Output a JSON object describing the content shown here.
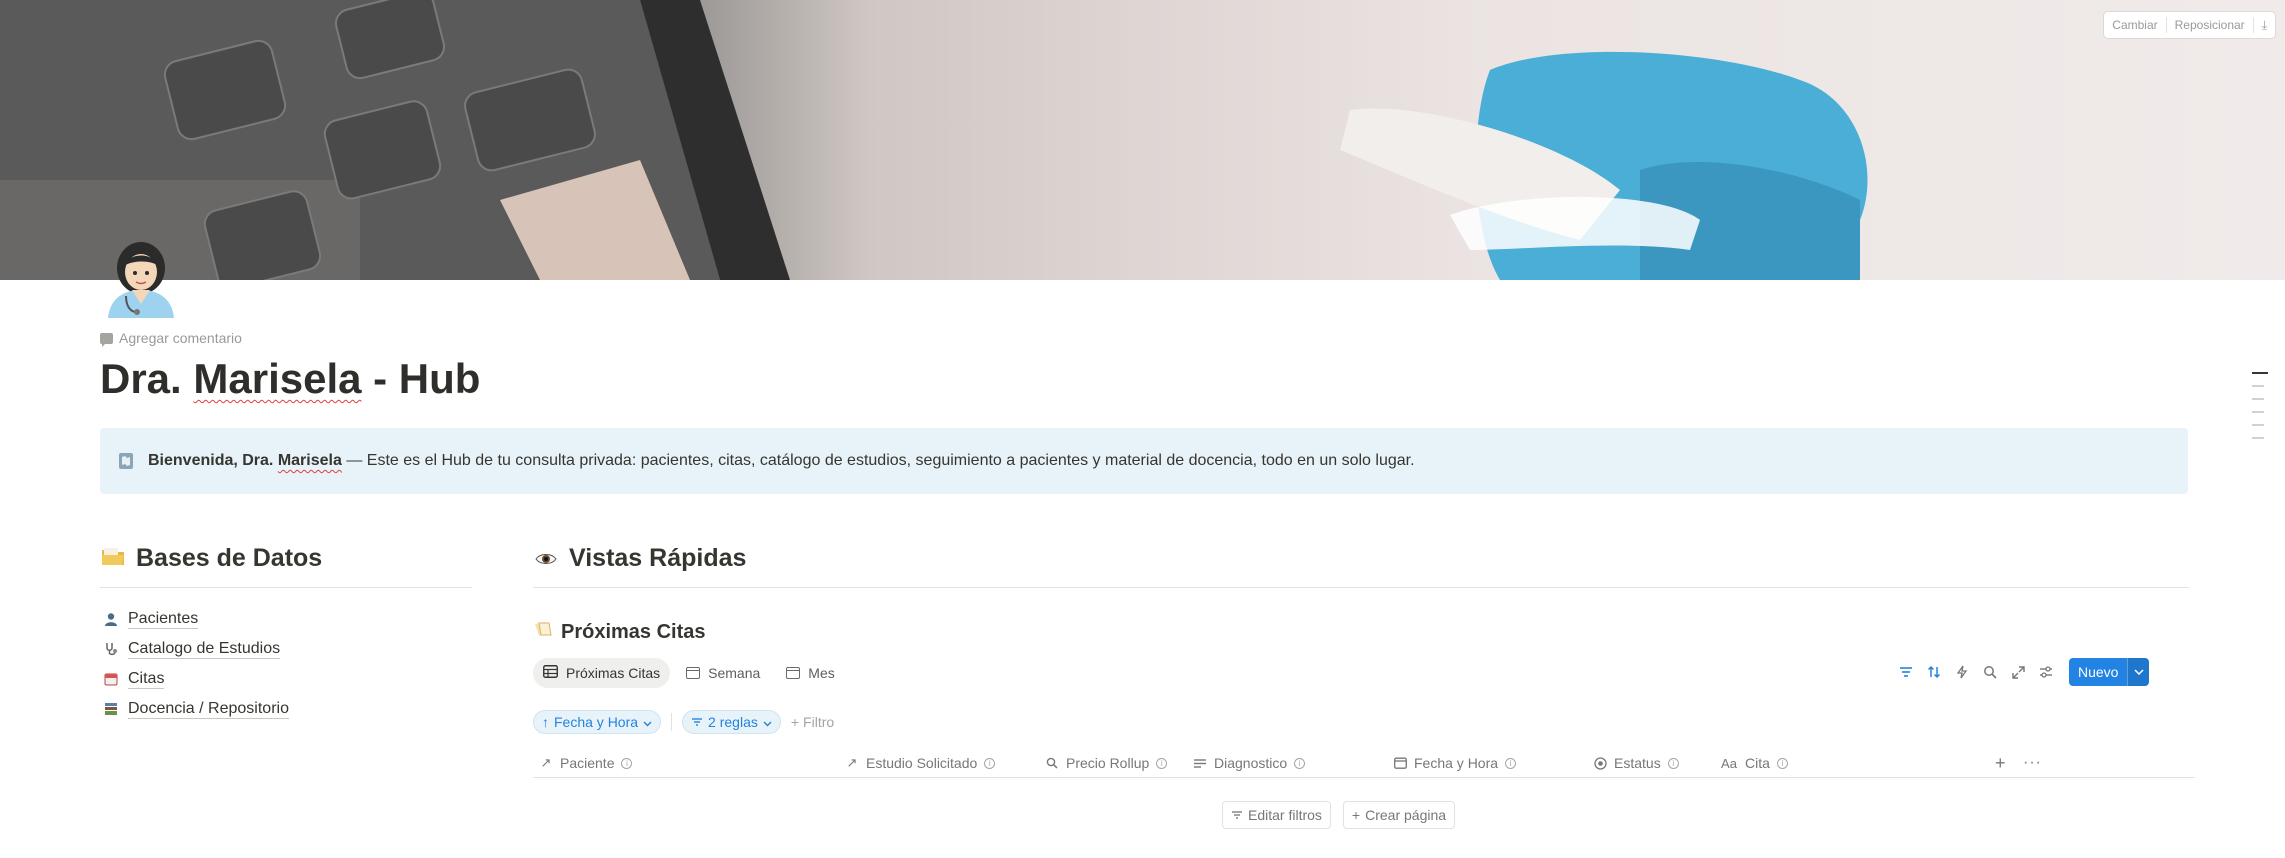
{
  "cover": {
    "change_label": "Cambiar",
    "reposition_label": "Reposicionar",
    "download_icon": "download-icon"
  },
  "page": {
    "icon": "doctor-woman-icon",
    "add_comment": "Agregar comentario",
    "title_prefix": "Dra.",
    "title_name": "Marisela",
    "title_suffix": "- Hub"
  },
  "callout": {
    "icon": "map-icon",
    "bold_prefix": "Bienvenida, Dra.",
    "bold_name": "Marisela",
    "text": " — Este es el Hub de tu consulta privada: pacientes, citas, catálogo de estudios, seguimiento a pacientes y material de docencia, todo en un solo lugar.",
    "bg_color": "#e7f3f8"
  },
  "databases": {
    "heading": "Bases de Datos",
    "heading_icon": "folder-icon",
    "items": [
      {
        "label": "Pacientes",
        "icon": "person-icon"
      },
      {
        "label": "Catalogo de Estudios",
        "icon": "stethoscope-icon"
      },
      {
        "label": "Citas",
        "icon": "calendar-icon"
      },
      {
        "label": "Docencia / Repositorio",
        "icon": "books-icon"
      }
    ]
  },
  "quick_views": {
    "heading": "Vistas Rápidas",
    "heading_icon": "eye-icon",
    "db_title": "Próximas Citas",
    "db_icon": "clipboard-icon",
    "tabs": [
      {
        "label": "Próximas Citas",
        "active": true
      },
      {
        "label": "Semana",
        "active": false
      },
      {
        "label": "Mes",
        "active": false
      }
    ],
    "toolbar": {
      "new_label": "Nuevo",
      "accent": "#2383e2"
    },
    "sort_pill": "Fecha y Hora",
    "rules_pill": "2 reglas",
    "add_filter": "Filtro",
    "columns": [
      {
        "label": "Paciente",
        "icon": "relation-arrow-icon"
      },
      {
        "label": "Estudio Solicitado",
        "icon": "relation-arrow-icon"
      },
      {
        "label": "Precio Rollup",
        "icon": "search-icon"
      },
      {
        "label": "Diagnostico",
        "icon": "text-lines-icon"
      },
      {
        "label": "Fecha y Hora",
        "icon": "calendar-icon"
      },
      {
        "label": "Estatus",
        "icon": "status-icon"
      },
      {
        "label": "Cita",
        "icon": "title-text-icon"
      }
    ],
    "edit_filters": "Editar filtros",
    "create_page": "Crear página"
  }
}
